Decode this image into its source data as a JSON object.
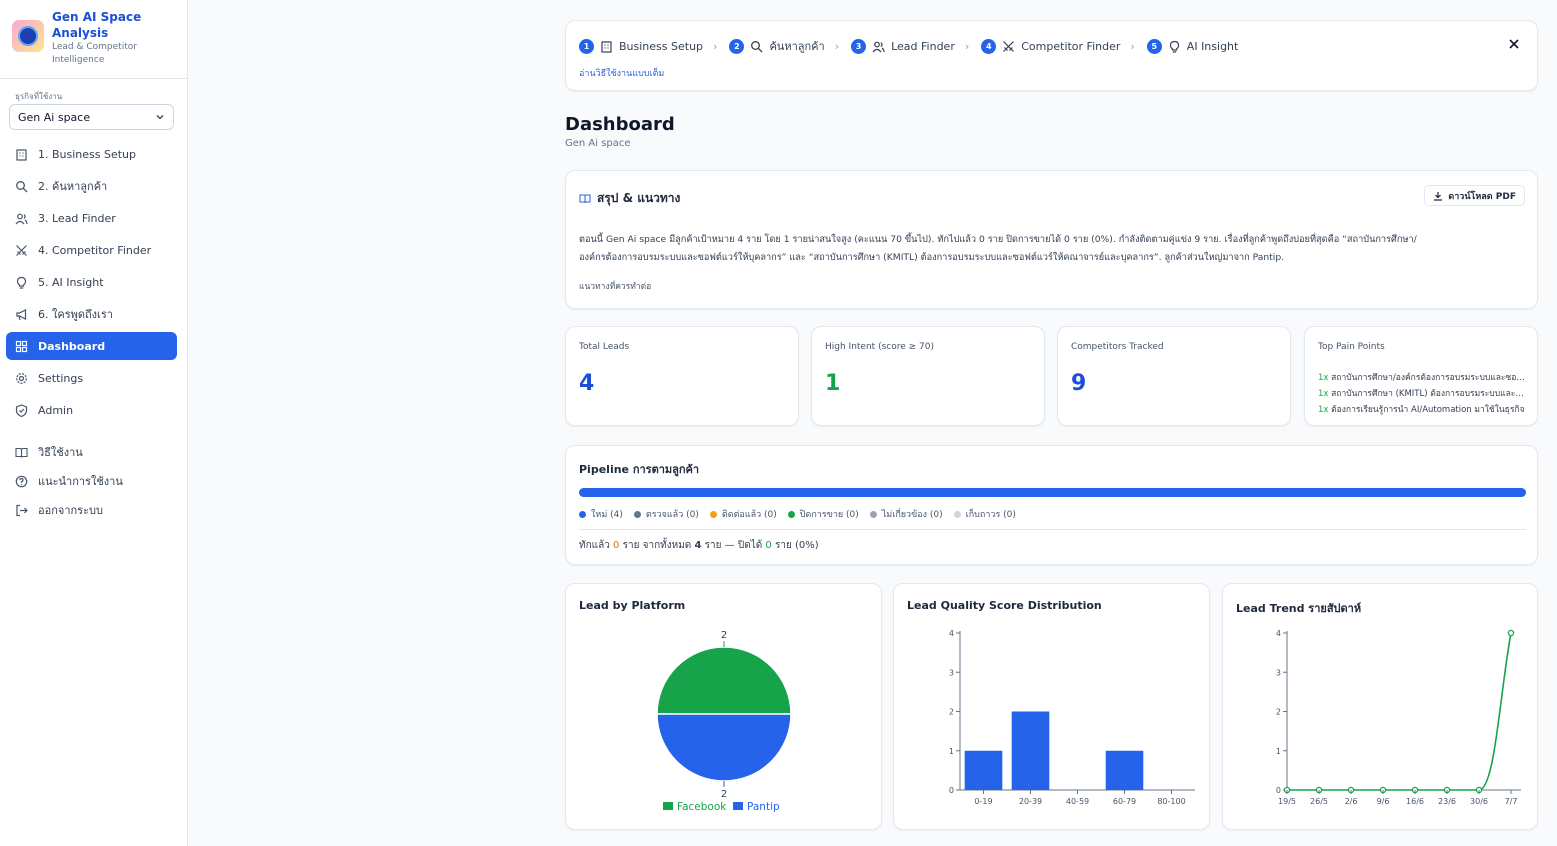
{
  "brand": {
    "title": "Gen AI Space Analysis",
    "subtitle": "Lead & Competitor Intelligence"
  },
  "workspace": {
    "label": "ธุรกิจที่ใช้งาน",
    "selected": "Gen Ai space"
  },
  "nav": [
    {
      "label": "1. Business Setup",
      "icon": "building-icon"
    },
    {
      "label": "2. ค้นหาลูกค้า",
      "icon": "search-icon"
    },
    {
      "label": "3. Lead Finder",
      "icon": "users-icon"
    },
    {
      "label": "4. Competitor Finder",
      "icon": "swords-icon"
    },
    {
      "label": "5. AI Insight",
      "icon": "lightbulb-icon"
    },
    {
      "label": "6. ใครพูดถึงเรา",
      "icon": "megaphone-icon"
    },
    {
      "label": "Dashboard",
      "icon": "grid-icon",
      "active": true
    },
    {
      "label": "Settings",
      "icon": "gear-icon"
    },
    {
      "label": "Admin",
      "icon": "shield-icon"
    }
  ],
  "nav_footer": [
    {
      "label": "วิธีใช้งาน",
      "icon": "book-icon"
    },
    {
      "label": "แนะนำการใช้งาน",
      "icon": "help-icon"
    },
    {
      "label": "ออกจากระบบ",
      "icon": "logout-icon"
    }
  ],
  "stepper": {
    "steps": [
      {
        "num": "1",
        "label": "Business Setup"
      },
      {
        "num": "2",
        "label": "ค้นหาลูกค้า"
      },
      {
        "num": "3",
        "label": "Lead Finder"
      },
      {
        "num": "4",
        "label": "Competitor Finder"
      },
      {
        "num": "5",
        "label": "AI Insight"
      }
    ],
    "link": "อ่านวิธีใช้งานแบบเต็ม"
  },
  "page": {
    "title": "Dashboard",
    "subtitle": "Gen Ai space"
  },
  "summary": {
    "title": "สรุป & แนวทาง",
    "download": "ดาวน์โหลด PDF",
    "line1": "ตอนนี้ Gen Ai space มีลูกค้าเป้าหมาย 4 ราย โดย 1 รายน่าสนใจสูง (คะแนน 70 ขึ้นไป). ทักไปแล้ว 0 ราย ปิดการขายได้ 0 ราย (0%). กำลังติดตามคู่แข่ง 9 ราย. เรื่องที่ลูกค้าพูดถึงบ่อยที่สุดคือ “สถาบันการศึกษา/",
    "line2": "องค์กรต้องการอบรมระบบและซอฟต์แวร์ให้บุคลากร” และ “สถาบันการศึกษา (KMITL) ต้องการอบรมระบบและซอฟต์แวร์ให้คณาจารย์และบุคลากร”. ลูกค้าส่วนใหญ่มาจาก Pantip.",
    "next": "แนวทางที่ควรทำต่อ"
  },
  "stats": {
    "total_leads": {
      "label": "Total Leads",
      "value": "4"
    },
    "high_intent": {
      "label": "High Intent (score ≥ 70)",
      "value": "1"
    },
    "competitors": {
      "label": "Competitors Tracked",
      "value": "9"
    },
    "pain_points": {
      "label": "Top Pain Points",
      "items": [
        {
          "count": "1x",
          "text": "สถาบันการศึกษา/องค์กรต้องการอบรมระบบและซอฟต์แวร์ให้บุคลากร"
        },
        {
          "count": "1x",
          "text": "สถาบันการศึกษา (KMITL) ต้องการอบรมระบบและซอฟต์แวร์"
        },
        {
          "count": "1x",
          "text": "ต้องการเรียนรู้การนำ AI/Automation มาใช้ในธุรกิจ"
        }
      ]
    }
  },
  "pipeline": {
    "title": "Pipeline การตามลูกค้า",
    "legend": [
      {
        "label": "ใหม่ (4)",
        "color": "#2563eb"
      },
      {
        "label": "ตรวจแล้ว (0)",
        "color": "#64748b"
      },
      {
        "label": "ติดต่อแล้ว (0)",
        "color": "#f59e0b"
      },
      {
        "label": "ปิดการขาย (0)",
        "color": "#16a34a"
      },
      {
        "label": "ไม่เกี่ยวข้อง (0)",
        "color": "#9ca3af"
      },
      {
        "label": "เก็บถาวร (0)",
        "color": "#d1d5db"
      }
    ],
    "footer": {
      "a": "ทักแล้ว",
      "b": "0",
      "c": "ราย จากทั้งหมด",
      "d": "4",
      "e": "ราย — ปิดได้",
      "f": "0",
      "g": "ราย (0%)"
    }
  },
  "chart_data": [
    {
      "type": "pie",
      "title": "Lead by Platform",
      "slices": [
        {
          "name": "Facebook",
          "value": 2,
          "color": "#16a34a"
        },
        {
          "name": "Pantip",
          "value": 2,
          "color": "#2563eb"
        }
      ]
    },
    {
      "type": "bar",
      "title": "Lead Quality Score Distribution",
      "categories": [
        "0-19",
        "20-39",
        "40-59",
        "60-79",
        "80-100"
      ],
      "values": [
        1,
        2,
        0,
        1,
        0
      ],
      "yticks": [
        "0",
        "1",
        "2",
        "3",
        "4"
      ],
      "ylim": [
        0,
        4
      ],
      "color": "#2563eb"
    },
    {
      "type": "line",
      "title": "Lead Trend รายสัปดาห์",
      "x": [
        "19/5",
        "26/5",
        "2/6",
        "9/6",
        "16/6",
        "23/6",
        "30/6",
        "7/7"
      ],
      "values": [
        0,
        0,
        0,
        0,
        0,
        0,
        0,
        4
      ],
      "yticks": [
        "0",
        "1",
        "2",
        "3",
        "4"
      ],
      "ylim": [
        0,
        4
      ],
      "color": "#16a34a"
    }
  ]
}
